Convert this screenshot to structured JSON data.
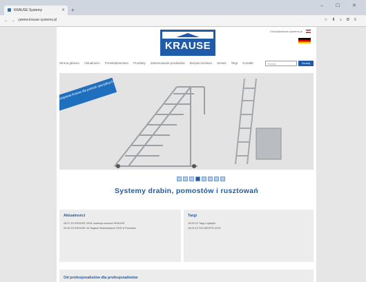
{
  "browser": {
    "tab_title": "KRAUSE Systemy",
    "url": "www.krause-systems.pl",
    "window_controls": "– ☐ ✕"
  },
  "site": {
    "logo_text": "KRAUSE",
    "top_right_text": "Kraus@krause-systems.pl",
    "menu": [
      "Strona główna",
      "Aktualności",
      "Przedsiębiorstwo",
      "Produkty",
      "Zastosowanie produktów",
      "Bezpieczeństwo",
      "Serwis",
      "Targi",
      "Kontakt"
    ],
    "search_placeholder": "Szukaj",
    "search_button": "Szukaj",
    "promo_text": "Rozwiązania Krause dla potrzeb specjalnych",
    "slider_count": 8,
    "slider_active": 3,
    "headline": "Systemy drabin, pomostów i rusztowań",
    "news": {
      "title": "Aktualności",
      "items": [
        {
          "date": "26.07.15",
          "text": "KRAUSE 2015: kolekcja nowości KRAUSE"
        },
        {
          "date": "20.06.15",
          "text": "KRAUSE na Targach Budowlanych 2015 w Poznaniu"
        }
      ]
    },
    "fairs": {
      "title": "Targi",
      "items": [
        {
          "date": "15.09.15",
          "text": "Targi Logistyki"
        },
        {
          "date": "18.09.15",
          "text": "SOLIDEXPO 2015"
        }
      ]
    },
    "bottom_heading": "Od profesjonalistów dla profesjonalistów"
  },
  "colors": {
    "brand_blue": "#1f5ba8",
    "promo_blue": "#1f6fbf"
  }
}
